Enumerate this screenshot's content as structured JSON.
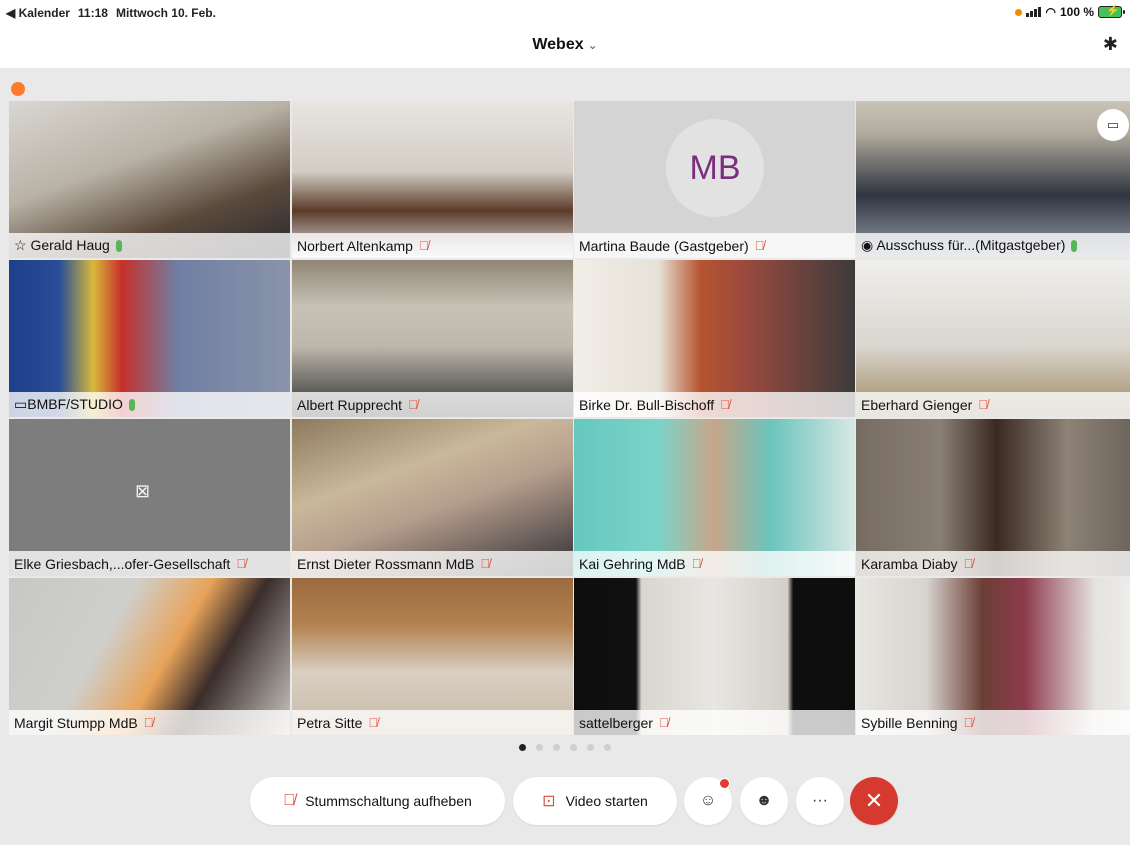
{
  "status_bar": {
    "back_label": "◀ Kalender",
    "time": "11:18",
    "date": "Mittwoch 10. Feb.",
    "battery": "100 %"
  },
  "header": {
    "title": "Webex",
    "chevron": "⌄"
  },
  "icons": {
    "bluetooth": "bluetooth-icon",
    "mic_muted": "mic-muted-icon",
    "camera_off": "camera-off-icon",
    "participants": "participants-icon",
    "reactions": "emoji-icon",
    "more": "more-icon",
    "end_call": "end-call-icon",
    "layout": "layout-icon"
  },
  "participants": [
    {
      "name": "Gerald Haug",
      "mic": "on",
      "prefix": "☆ "
    },
    {
      "name": "Norbert Altenkamp",
      "mic": "muted"
    },
    {
      "name": "Martina Baude (Gastgeber)",
      "mic": "muted",
      "avatar_initials": "MB"
    },
    {
      "name": "Ausschuss für...(Mitgastgeber)",
      "mic": "on"
    },
    {
      "name": "BMBF/STUDIO",
      "mic": "on"
    },
    {
      "name": "Albert Rupprecht",
      "mic": "muted"
    },
    {
      "name": "Birke Dr. Bull-Bischoff",
      "mic": "muted"
    },
    {
      "name": "Eberhard Gienger",
      "mic": "muted"
    },
    {
      "name": "Elke Griesbach,...ofer-Gesellschaft",
      "mic": "muted"
    },
    {
      "name": "Ernst Dieter Rossmann MdB",
      "mic": "muted"
    },
    {
      "name": "Kai Gehring MdB",
      "mic": "muted"
    },
    {
      "name": "Karamba Diaby",
      "mic": "muted"
    },
    {
      "name": "Margit Stumpp MdB",
      "mic": "muted"
    },
    {
      "name": "Petra Sitte",
      "mic": "muted"
    },
    {
      "name": "sattelberger",
      "mic": "muted"
    },
    {
      "name": "Sybille Benning",
      "mic": "muted"
    }
  ],
  "pagination": {
    "pages": 6,
    "current": 1
  },
  "controls": {
    "unmute_label": "Stummschaltung aufheben",
    "video_label": "Video starten",
    "more_label": "···",
    "end_label": "✕"
  },
  "colors": {
    "active_border": "#1a73c9",
    "muted_mic": "#e0503a",
    "mic_on": "#5ab55a",
    "end_call": "#d63a2e",
    "avatar_text": "#7c2d7f"
  }
}
